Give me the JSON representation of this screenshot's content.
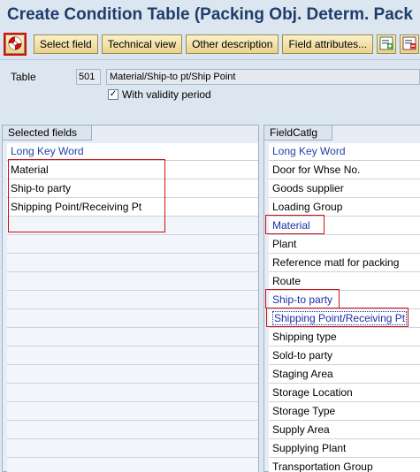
{
  "title": "Create Condition Table (Packing Obj. Determ. Pack",
  "toolbar": {
    "generate_icon": "red-white-circle-icon",
    "buttons": [
      "Select field",
      "Technical view",
      "Other description",
      "Field attributes..."
    ],
    "icons": [
      "add-icon",
      "remove-icon"
    ]
  },
  "table": {
    "label": "Table",
    "code": "501",
    "description": "Material/Ship-to pt/Ship Point",
    "validity_label": "With validity period",
    "validity_checked": true
  },
  "selected_fields": {
    "tab_label": "Selected fields",
    "column_header": "Long Key Word",
    "items": [
      "Material",
      "Ship-to party",
      "Shipping Point/Receiving Pt"
    ]
  },
  "field_catalog": {
    "tab_label": "FieldCatlg",
    "column_header": "Long Key Word",
    "items": [
      "Door for Whse No.",
      "Goods supplier",
      "Loading Group",
      "Material",
      "Plant",
      "Reference matl for packing",
      "Route",
      "Ship-to party",
      "Shipping Point/Receiving Pt",
      "Shipping type",
      "Sold-to party",
      "Staging Area",
      "Storage Location",
      "Storage Type",
      "Supply Area",
      "Supplying Plant",
      "Transportation Group"
    ]
  },
  "colors": {
    "highlight": "#d01010",
    "title": "#1f3d6b",
    "link_blue": "#1c2ea8"
  }
}
